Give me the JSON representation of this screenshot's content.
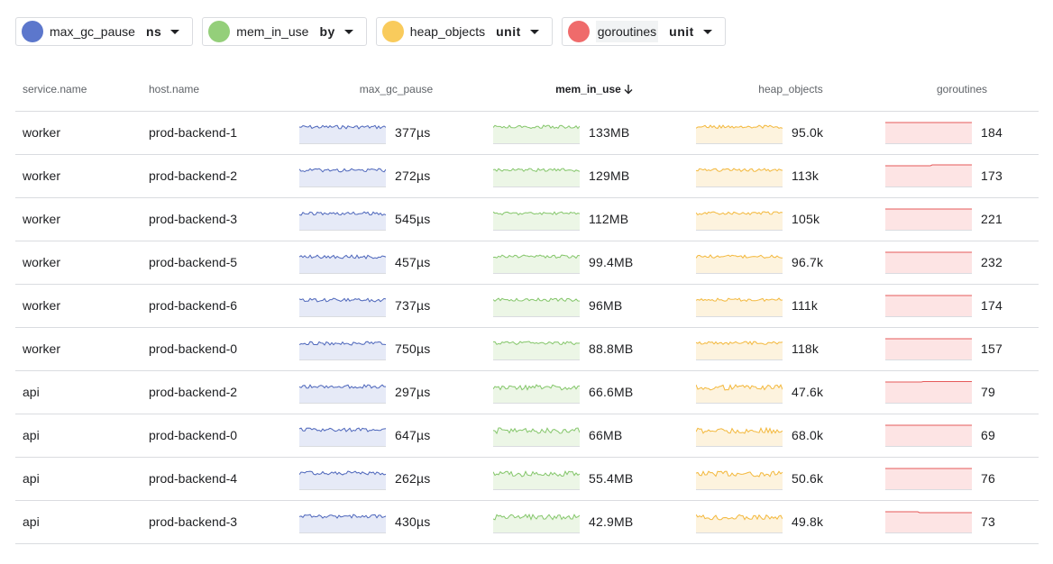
{
  "metrics": [
    {
      "name": "max_gc_pause",
      "unit": "ns",
      "color": "#5c77cc",
      "fill": "#e6eaf7",
      "line": "#4d66bb"
    },
    {
      "name": "mem_in_use",
      "unit": "by",
      "color": "#94cf7a",
      "fill": "#ecf6e6",
      "line": "#84c66a"
    },
    {
      "name": "heap_objects",
      "unit": "unit",
      "color": "#f9cb5c",
      "fill": "#fdf3de",
      "line": "#f3b83c"
    },
    {
      "name": "goroutines",
      "unit": "unit",
      "color": "#ef6b6b",
      "fill": "#fde4e4",
      "line": "#e55a5a"
    }
  ],
  "columns": {
    "service": "service.name",
    "host": "host.name",
    "m0": "max_gc_pause",
    "m1": "mem_in_use",
    "m2": "heap_objects",
    "m3": "goroutines"
  },
  "rows": [
    {
      "service": "worker",
      "host": "prod-backend-1",
      "v0": "377µs",
      "v1": "133MB",
      "v2": "95.0k",
      "v3": "184"
    },
    {
      "service": "worker",
      "host": "prod-backend-2",
      "v0": "272µs",
      "v1": "129MB",
      "v2": "113k",
      "v3": "173"
    },
    {
      "service": "worker",
      "host": "prod-backend-3",
      "v0": "545µs",
      "v1": "112MB",
      "v2": "105k",
      "v3": "221"
    },
    {
      "service": "worker",
      "host": "prod-backend-5",
      "v0": "457µs",
      "v1": "99.4MB",
      "v2": "96.7k",
      "v3": "232"
    },
    {
      "service": "worker",
      "host": "prod-backend-6",
      "v0": "737µs",
      "v1": "96MB",
      "v2": "111k",
      "v3": "174"
    },
    {
      "service": "worker",
      "host": "prod-backend-0",
      "v0": "750µs",
      "v1": "88.8MB",
      "v2": "118k",
      "v3": "157"
    },
    {
      "service": "api",
      "host": "prod-backend-2",
      "v0": "297µs",
      "v1": "66.6MB",
      "v2": "47.6k",
      "v3": "79"
    },
    {
      "service": "api",
      "host": "prod-backend-0",
      "v0": "647µs",
      "v1": "66MB",
      "v2": "68.0k",
      "v3": "69"
    },
    {
      "service": "api",
      "host": "prod-backend-4",
      "v0": "262µs",
      "v1": "55.4MB",
      "v2": "50.6k",
      "v3": "76"
    },
    {
      "service": "api",
      "host": "prod-backend-3",
      "v0": "430µs",
      "v1": "42.9MB",
      "v2": "49.8k",
      "v3": "73"
    }
  ]
}
